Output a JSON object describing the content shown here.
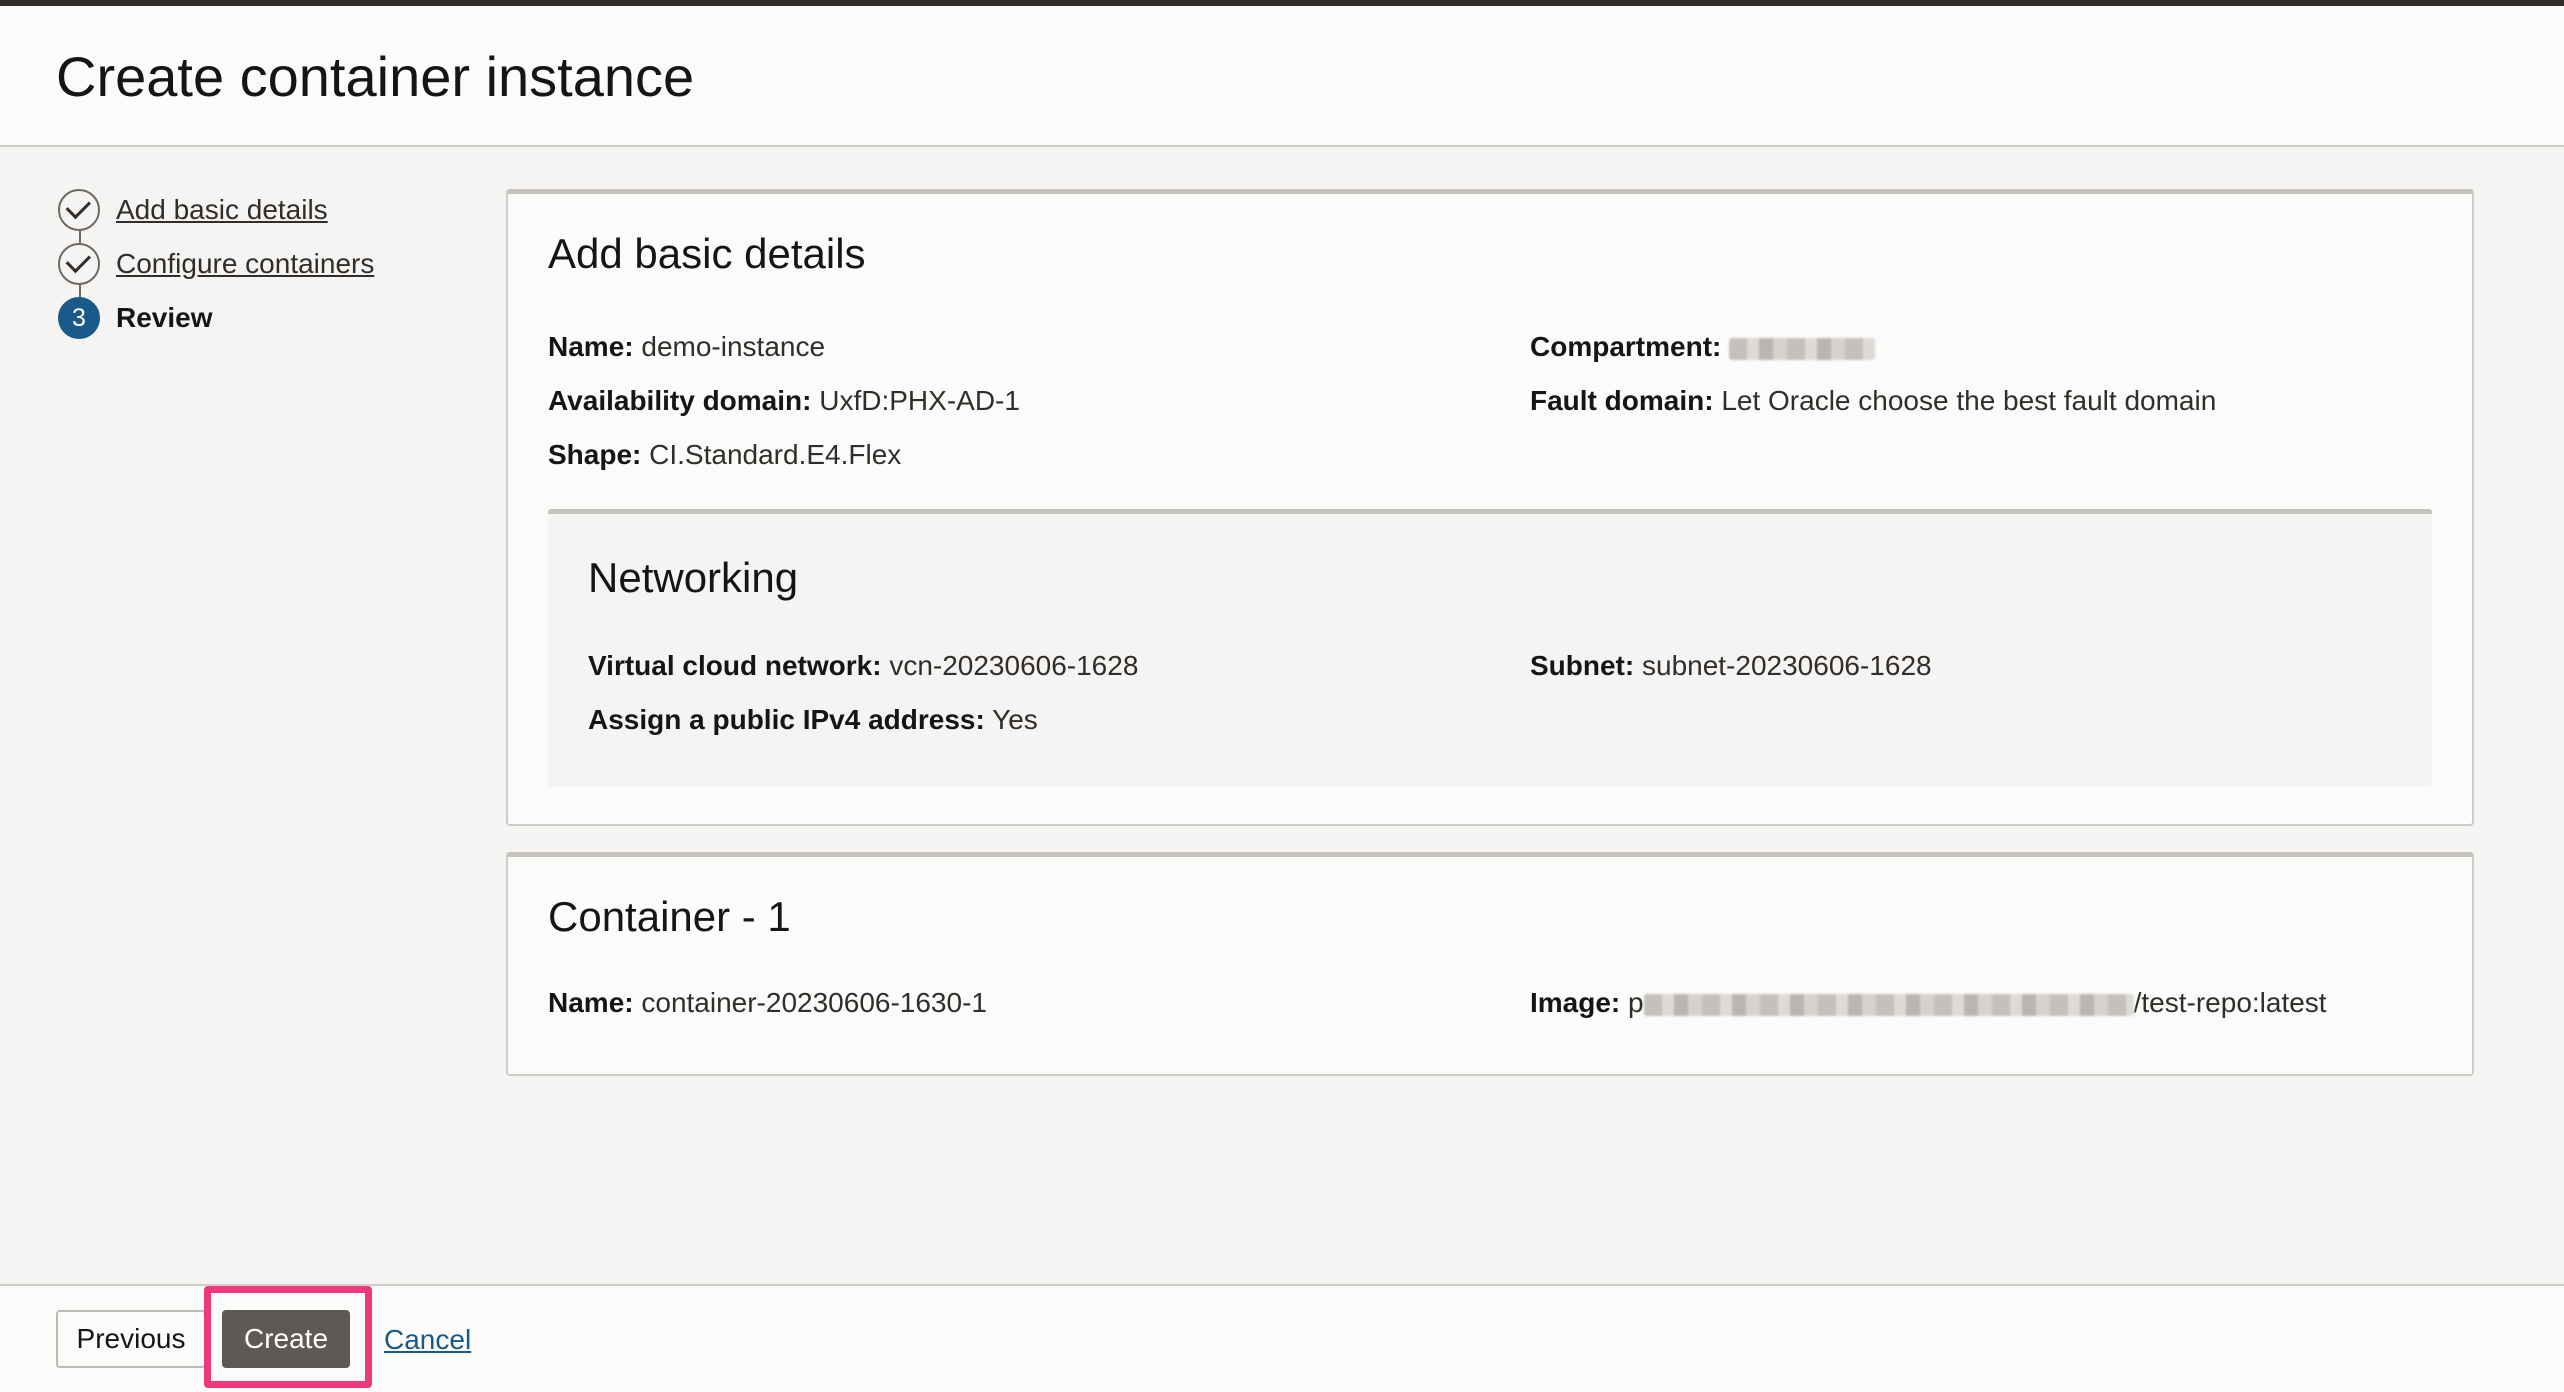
{
  "header": {
    "title": "Create container instance"
  },
  "stepper": {
    "steps": [
      {
        "label": "Add basic details",
        "state": "completed"
      },
      {
        "label": "Configure containers",
        "state": "completed"
      },
      {
        "label": "Review",
        "state": "current",
        "number": "3"
      }
    ]
  },
  "basic": {
    "title": "Add basic details",
    "name_label": "Name:",
    "name_value": "demo-instance",
    "compartment_label": "Compartment:",
    "compartment_value": "",
    "ad_label": "Availability domain:",
    "ad_value": "UxfD:PHX-AD-1",
    "fault_label": "Fault domain:",
    "fault_value": "Let Oracle choose the best fault domain",
    "shape_label": "Shape:",
    "shape_value": "CI.Standard.E4.Flex"
  },
  "networking": {
    "title": "Networking",
    "vcn_label": "Virtual cloud network:",
    "vcn_value": "vcn-20230606-1628",
    "subnet_label": "Subnet:",
    "subnet_value": "subnet-20230606-1628",
    "ip_label": "Assign a public IPv4 address:",
    "ip_value": "Yes"
  },
  "container": {
    "title": "Container - 1",
    "name_label": "Name:",
    "name_value": "container-20230606-1630-1",
    "image_label": "Image:",
    "image_prefix": "p",
    "image_suffix": "/test-repo:latest"
  },
  "footer": {
    "previous_label": "Previous",
    "create_label": "Create",
    "cancel_label": "Cancel"
  },
  "colors": {
    "accent": "#1a5a8a",
    "highlight": "#f0387c",
    "primary_button": "#5f5955"
  }
}
